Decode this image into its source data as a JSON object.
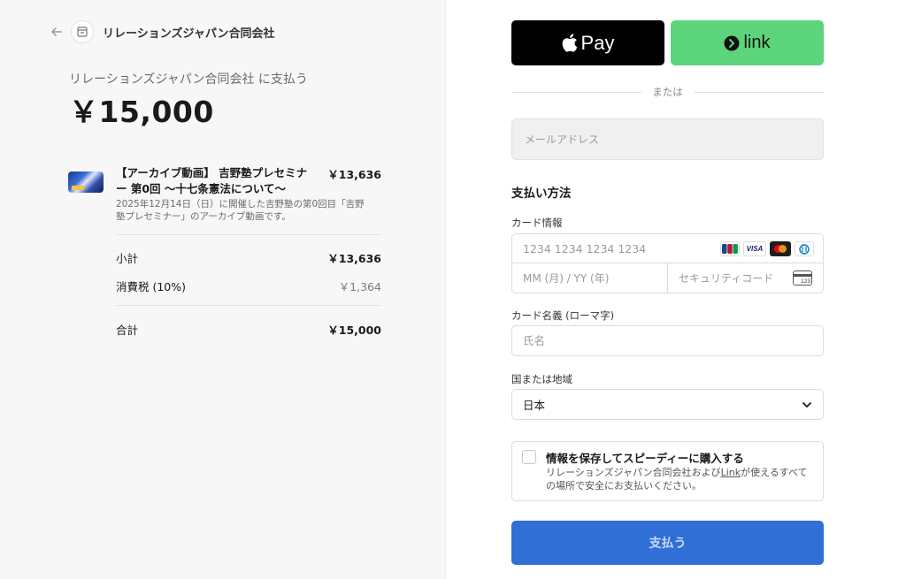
{
  "merchant": {
    "name": "リレーションズジャパン合同会社"
  },
  "summary": {
    "pay_to": "リレーションズジャパン合同会社 に支払う",
    "amount": "￥15,000"
  },
  "line_item": {
    "title": "【アーカイブ動画】 吉野塾プレセミナー 第0回 〜十七条憲法について〜",
    "price": "￥13,636",
    "description": "2025年12月14日（日）に開催した吉野塾の第0回目「吉野塾プレセミナー」のアーカイブ動画です。"
  },
  "totals": {
    "subtotal_label": "小計",
    "subtotal_value": "￥13,636",
    "tax_label": "消費税 (10%)",
    "tax_value": "￥1,364",
    "total_label": "合計",
    "total_value": "￥15,000"
  },
  "express": {
    "apple_pay_label": "Pay",
    "link_label": "link",
    "or_text": "または"
  },
  "email": {
    "placeholder": "メールアドレス"
  },
  "payment": {
    "section_title": "支払い方法",
    "card_label": "カード情報",
    "card_number_placeholder": "1234 1234 1234 1234",
    "expiry_placeholder": "MM (月) / YY (年)",
    "cvc_placeholder": "セキュリティコード",
    "brands": [
      "JCB",
      "VISA",
      "Mastercard",
      "Diners"
    ],
    "cvc_icon_text": "123",
    "name_label": "カード名義 (ローマ字)",
    "name_placeholder": "氏名",
    "country_label": "国または地域",
    "country_value": "日本"
  },
  "save_info": {
    "title": "情報を保存してスピーディーに購入する",
    "desc_before": "リレーションズジャパン合同会社および",
    "desc_link": "Link",
    "desc_after": "が使えるすべての場所で安全にお支払いください。"
  },
  "pay_button": {
    "label": "支払う"
  },
  "colors": {
    "link_green": "#5cd47b",
    "pay_blue": "#2f6fd6",
    "left_bg": "#f7f7f7"
  }
}
